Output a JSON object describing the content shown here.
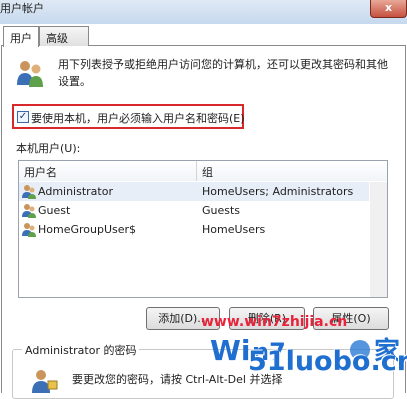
{
  "window": {
    "title": "用户帐户",
    "close_label": "x"
  },
  "tabs": [
    {
      "label": "用户"
    },
    {
      "label": "高级"
    }
  ],
  "description": "用下列表授予或拒绝用户访问您的计算机，还可以更改其密码和其他设置。",
  "require_login": {
    "label": "要使用本机，用户必须输入用户名和密码(E)",
    "checked_mark": "✓"
  },
  "users_list": {
    "title": "本机用户(U):",
    "columns": [
      "用户名",
      "组"
    ],
    "rows": [
      {
        "name": "Administrator",
        "group": "HomeUsers; Administrators"
      },
      {
        "name": "Guest",
        "group": "Guests"
      },
      {
        "name": "HomeGroupUser$",
        "group": "HomeUsers"
      }
    ]
  },
  "buttons": {
    "add": "添加(D)...",
    "remove": "删除(R)",
    "properties": "属性(O)"
  },
  "password_group": {
    "title": "Administrator 的密码",
    "text": "要更改您的密码，请按 Ctrl-Alt-Del 并选择"
  },
  "watermark": {
    "url": "www.win7zhijia.cn",
    "logo": "51luobo.cn"
  },
  "colors": {
    "highlight": "#d8282c",
    "watermark_red": "#e8233a",
    "watermark_blue": "#1f6fd0"
  }
}
